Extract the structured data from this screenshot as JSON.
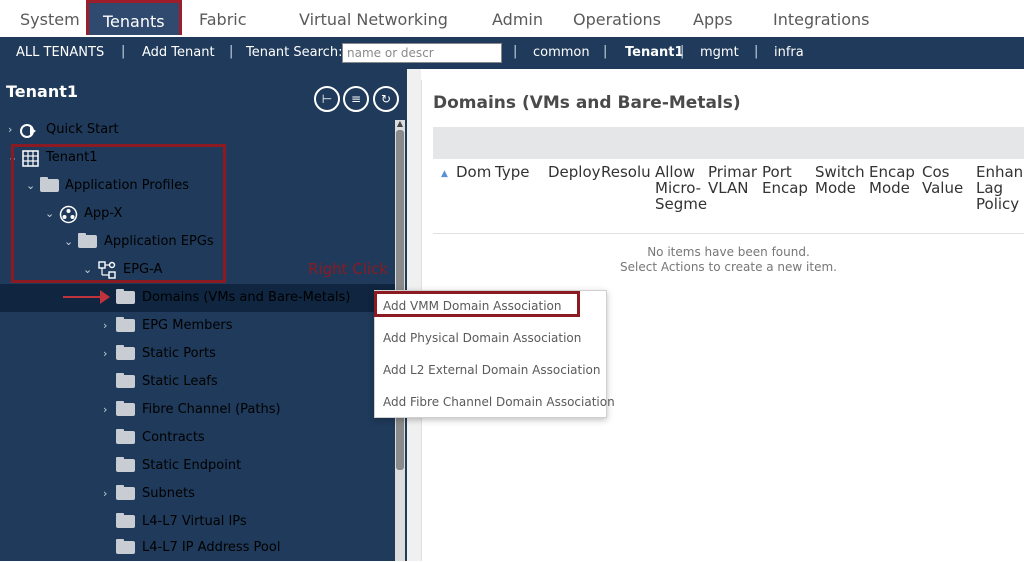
{
  "top_tabs": [
    "System",
    "Tenants",
    "Fabric",
    "Virtual Networking",
    "Admin",
    "Operations",
    "Apps",
    "Integrations"
  ],
  "active_tab": "Tenants",
  "subnav": {
    "all_tenants": "ALL TENANTS",
    "add_tenant": "Add Tenant",
    "search_label": "Tenant Search:",
    "search_placeholder": "name or descr",
    "tenants": [
      "common",
      "Tenant1",
      "mgmt",
      "infra"
    ],
    "active_tenant": "Tenant1"
  },
  "left_pane": {
    "title": "Tenant1",
    "tree": [
      {
        "label": "Quick Start",
        "icon": "quick-start-icon"
      },
      {
        "label": "Tenant1",
        "icon": "tenant-grid-icon"
      },
      {
        "label": "Application Profiles",
        "icon": "folder-icon"
      },
      {
        "label": "App-X",
        "icon": "app-profile-icon"
      },
      {
        "label": "Application EPGs",
        "icon": "folder-icon"
      },
      {
        "label": "EPG-A",
        "icon": "epg-icon"
      },
      {
        "label": "Domains (VMs and Bare-Metals)",
        "icon": "folder-icon"
      },
      {
        "label": "EPG Members",
        "icon": "folder-icon"
      },
      {
        "label": "Static Ports",
        "icon": "folder-icon"
      },
      {
        "label": "Static Leafs",
        "icon": "folder-icon"
      },
      {
        "label": "Fibre Channel (Paths)",
        "icon": "folder-icon"
      },
      {
        "label": "Contracts",
        "icon": "folder-icon"
      },
      {
        "label": "Static Endpoint",
        "icon": "folder-icon"
      },
      {
        "label": "Subnets",
        "icon": "folder-icon"
      },
      {
        "label": "L4-L7 Virtual IPs",
        "icon": "folder-icon"
      },
      {
        "label": "L4-L7 IP Address Pool",
        "icon": "folder-icon"
      }
    ]
  },
  "right_pane": {
    "title": "Domains (VMs and Bare-Metals)",
    "columns": [
      "Dom",
      "Type",
      "Deploy",
      "Resolu",
      "Allow Micro-Segme",
      "Primar VLAN",
      "Port Encap",
      "Switch Mode",
      "Encap Mode",
      "Cos Value",
      "Enhan Lag Policy"
    ],
    "empty_line1": "No items have been found.",
    "empty_line2": "Select Actions to create a new item."
  },
  "context_menu": {
    "items": [
      "Add VMM Domain Association",
      "Add Physical Domain Association",
      "Add L2 External Domain Association",
      "Add Fibre Channel Domain Association"
    ]
  },
  "annotation": {
    "right_click": "Right Click"
  },
  "colors": {
    "nav_dark": "#1f3a5a",
    "highlight_red": "#8b1a23"
  }
}
